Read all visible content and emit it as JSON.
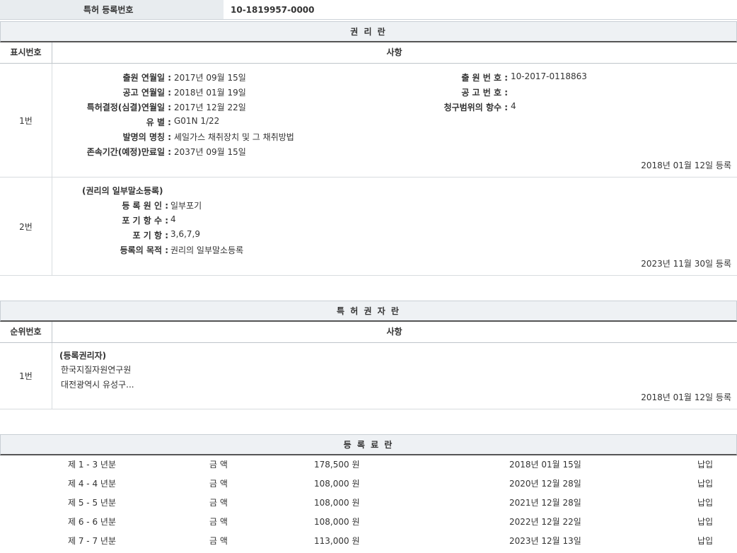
{
  "header": {
    "regno_label": "특허 등록번호",
    "regno_value": "10-1819957-0000"
  },
  "rights": {
    "title": "권 리 란",
    "col_num": "표시번호",
    "col_desc": "사항",
    "rows": [
      {
        "num": "1번",
        "left": [
          {
            "label": "출원 연월일 :",
            "value": "2017년 09월 15일"
          },
          {
            "label": "공고 연월일 :",
            "value": "2018년 01월 19일"
          },
          {
            "label": "특허결정(심결)연월일 :",
            "value": "2017년 12월 22일"
          },
          {
            "label": "유 별 :",
            "value": "G01N 1/22"
          },
          {
            "label": "발명의 명칭 :",
            "value": "셰일가스 채취장치 및 그 채취방법"
          },
          {
            "label": "존속기간(예정)만료일 :",
            "value": "2037년 09월 15일"
          }
        ],
        "right": [
          {
            "label": "출 원 번 호 :",
            "value": "10-2017-0118863"
          },
          {
            "label": "공 고 번 호 :",
            "value": ""
          },
          {
            "label": "청구범위의 항수 :",
            "value": "4"
          }
        ],
        "reg_date": "2018년 01월 12일 등록"
      },
      {
        "num": "2번",
        "heading": "(권리의 일부말소등록)",
        "left": [
          {
            "label": "등 록 원 인 :",
            "value": "일부포기"
          },
          {
            "label": "포 기 항 수 :",
            "value": "4"
          },
          {
            "label": "포 기 항 :",
            "value": "3,6,7,9"
          },
          {
            "label": "등록의 목적 :",
            "value": "권리의 일부말소등록"
          }
        ],
        "reg_date": "2023년 11월 30일 등록"
      }
    ]
  },
  "holders": {
    "title": "특 허 권 자 란",
    "col_num": "순위번호",
    "col_desc": "사항",
    "rows": [
      {
        "num": "1번",
        "heading": "(등록권리자)",
        "name": "한국지질자원연구원",
        "address": "대전광역시 유성구...",
        "reg_date": "2018년 01월 12일 등록"
      }
    ]
  },
  "fees": {
    "title": "등 록 료 란",
    "rows": [
      {
        "period": "제 1 - 3 년분",
        "amount_label": "금 액",
        "amount": "178,500 원",
        "date": "2018년 01월 15일",
        "status": "납입"
      },
      {
        "period": "제 4 - 4 년분",
        "amount_label": "금 액",
        "amount": "108,000 원",
        "date": "2020년 12월 28일",
        "status": "납입"
      },
      {
        "period": "제 5 - 5 년분",
        "amount_label": "금 액",
        "amount": "108,000 원",
        "date": "2021년 12월 28일",
        "status": "납입"
      },
      {
        "period": "제 6 - 6 년분",
        "amount_label": "금 액",
        "amount": "108,000 원",
        "date": "2022년 12월 22일",
        "status": "납입"
      },
      {
        "period": "제 7 - 7 년분",
        "amount_label": "금 액",
        "amount": "113,000 원",
        "date": "2023년 12월 13일",
        "status": "납입"
      }
    ]
  }
}
